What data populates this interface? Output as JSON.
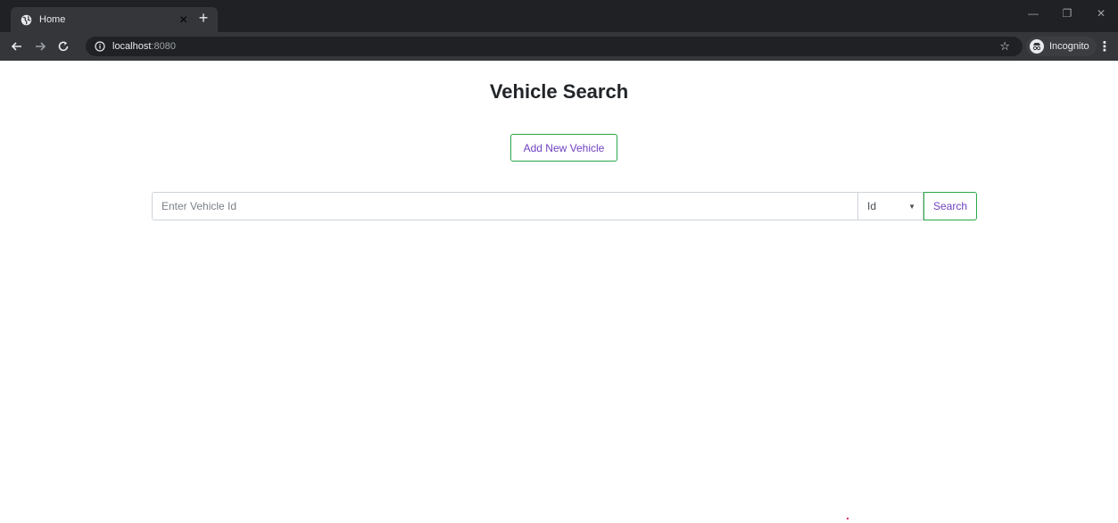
{
  "browser": {
    "tab_title": "Home",
    "tab_close": "×",
    "new_tab": "+",
    "url_host": "localhost",
    "url_port": ":8080",
    "profile_label": "Incognito",
    "window_minimize": "—",
    "window_restore": "❐",
    "window_close": "✕"
  },
  "page": {
    "title": "Vehicle Search",
    "add_button": "Add New Vehicle",
    "search": {
      "placeholder": "Enter Vehicle Id",
      "value": "",
      "type_selected": "Id",
      "button": "Search"
    }
  },
  "colors": {
    "accent_border": "#28a745",
    "accent_text": "#6f42c1"
  }
}
